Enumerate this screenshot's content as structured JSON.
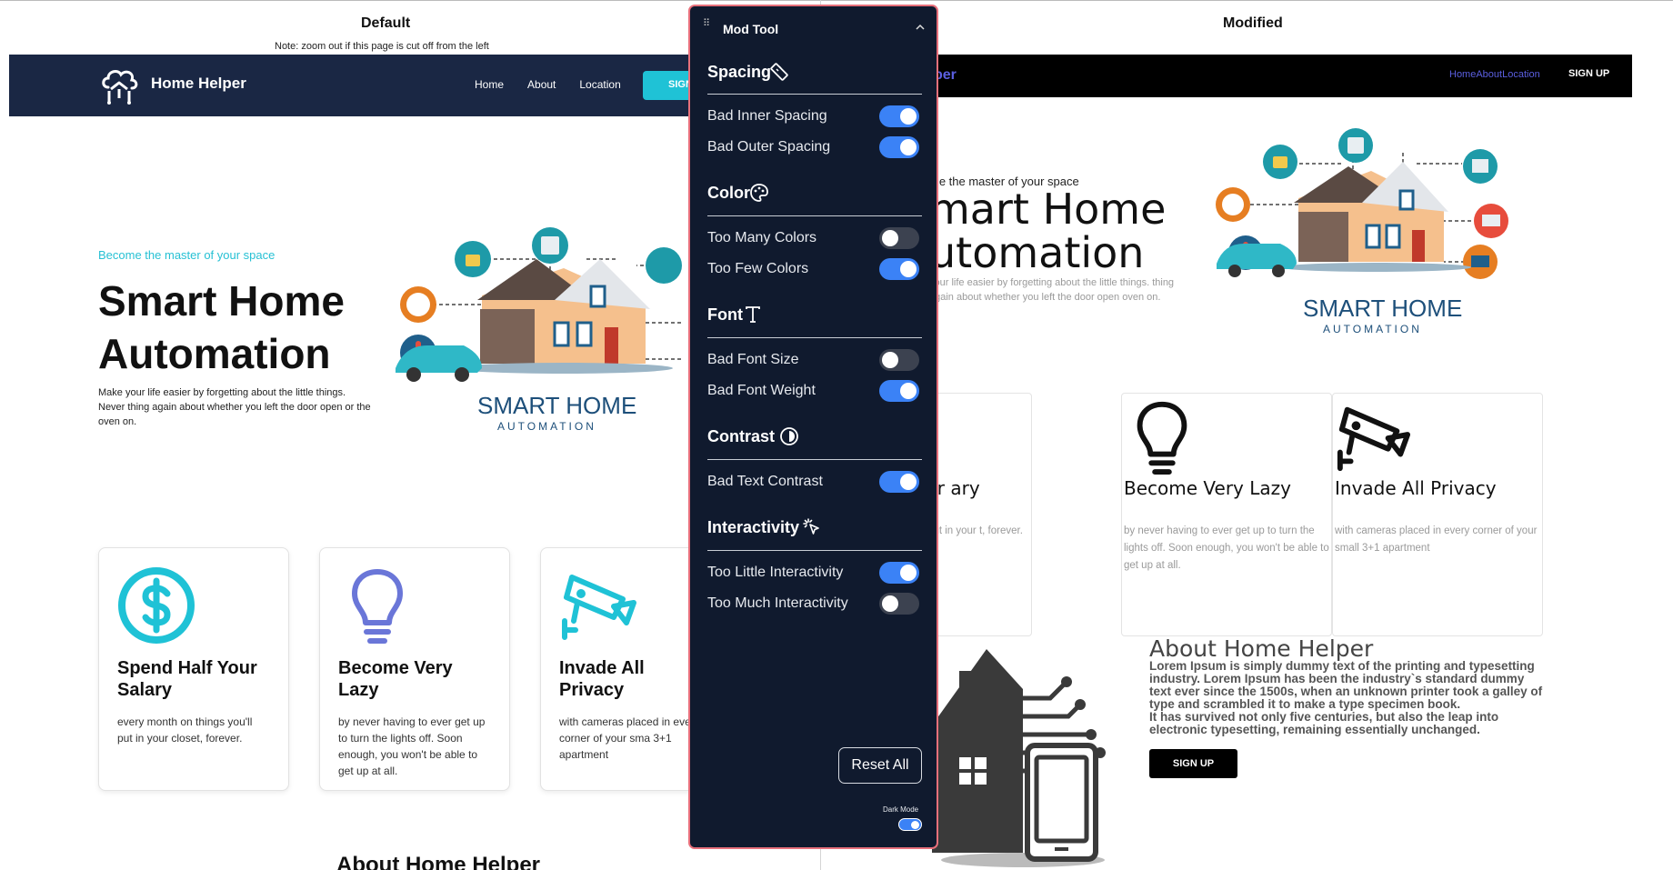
{
  "labels": {
    "default": "Default",
    "modified": "Modified",
    "note": "Note: zoom out if this page is cut off from the left"
  },
  "default_site": {
    "brand": "Home Helper",
    "nav_links": [
      "Home",
      "About",
      "Location"
    ],
    "signup": "SIGN",
    "tagline": "Become the master of your space",
    "title": "Smart Home Automation",
    "description": "Make your life easier by forgetting about the little things. Never thing again about whether you left the door open or the oven on.",
    "logo_text": "SMART HOME",
    "logo_sub": "AUTOMATION",
    "cards": [
      {
        "title": "Spend Half Your Salary",
        "text": "every month on things you'll put in your closet, forever.",
        "icon": "dollar-icon"
      },
      {
        "title": "Become Very Lazy",
        "text": "by never having to ever get up to turn the lights off. Soon enough, you won't be able to get up at all.",
        "icon": "lightbulb-icon"
      },
      {
        "title": "Invade All Privacy",
        "text": "with cameras placed in every corner of your sma 3+1 apartment",
        "icon": "camera-icon"
      }
    ],
    "about_title": "About Home Helper",
    "colors": {
      "nav": "#1a2744",
      "accent": "#1fc2d6",
      "card_icon_1": "#1fc2d6",
      "card_icon_2": "#6a76d8"
    }
  },
  "modified_site": {
    "brand": "per",
    "nav_links": [
      "Home",
      "About",
      "Location"
    ],
    "signup": "SIGN UP",
    "tagline": "me the master of your space",
    "title": "mart Home utomation",
    "description": "your life easier by forgetting about the little things. thing again about whether you left the door open oven on.",
    "logo_text": "SMART HOME",
    "logo_sub": "AUTOMATION",
    "cards": [
      {
        "title": "end Half Your ary",
        "text": "month on things you'll put in your t, forever.",
        "icon": "dollar-icon"
      },
      {
        "title": "Become Very Lazy",
        "text": "by never having to ever get up to turn the lights off. Soon enough, you won't be able to get up at all.",
        "icon": "lightbulb-icon"
      },
      {
        "title": "Invade All Privacy",
        "text": "with cameras placed in every corner of your small 3+1 apartment",
        "icon": "camera-icon"
      }
    ],
    "about_title": "About Home Helper",
    "about_body_1": "Lorem Ipsum is simply dummy text of the printing and typesetting industry. Lorem Ipsum has been the industry`s standard dummy text ever since the 1500s, when an unknown printer took a galley of type and scrambled it to make a type specimen book.",
    "about_body_2": "It has survived not only five centuries, but also the leap into electronic typesetting, remaining essentially unchanged.",
    "about_button": "SIGN UP",
    "colors": {
      "nav": "#000000",
      "link": "#5b5fe0"
    }
  },
  "mod_tool": {
    "title": "Mod Tool",
    "sections": [
      {
        "name": "Spacing",
        "icon": "ruler-icon",
        "options": [
          {
            "label": "Bad Inner Spacing",
            "on": true
          },
          {
            "label": "Bad Outer Spacing",
            "on": true
          }
        ]
      },
      {
        "name": "Color",
        "icon": "palette-icon",
        "options": [
          {
            "label": "Too Many Colors",
            "on": false
          },
          {
            "label": "Too Few Colors",
            "on": true
          }
        ]
      },
      {
        "name": "Font",
        "icon": "type-icon",
        "options": [
          {
            "label": "Bad Font Size",
            "on": false
          },
          {
            "label": "Bad Font Weight",
            "on": true
          }
        ]
      },
      {
        "name": "Contrast",
        "icon": "contrast-icon",
        "options": [
          {
            "label": "Bad Text Contrast",
            "on": true
          }
        ]
      },
      {
        "name": "Interactivity",
        "icon": "pointer-click-icon",
        "options": [
          {
            "label": "Too Little Interactivity",
            "on": true
          },
          {
            "label": "Too Much Interactivity",
            "on": false
          }
        ]
      }
    ],
    "reset": "Reset All",
    "dark_mode_label": "Dark Mode",
    "dark_mode_on": true,
    "colors": {
      "panel": "#101a2e",
      "border": "#e8707b",
      "toggle_on": "#3b82f6",
      "toggle_off": "#3c4250"
    }
  }
}
